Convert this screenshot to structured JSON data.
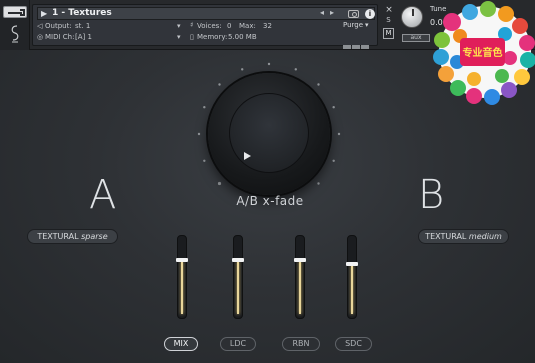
{
  "header": {
    "instrument_name": "1 - Textures",
    "output_label": "Output:",
    "output_value": "st. 1",
    "midi_label": "MIDI Ch:",
    "midi_value": "[A]  1",
    "voices_label": "Voices:",
    "voices_value": "0",
    "max_label": "Max:",
    "max_value": "32",
    "memory_label": "Memory:",
    "memory_value": "5.00 MB",
    "purge_label": "Purge",
    "info_label": "i",
    "close_label": "×",
    "s_label": "S",
    "m_label": "M",
    "tune_label": "Tune",
    "tune_value": "0.00",
    "aux_label": "aux"
  },
  "main": {
    "knob_label": "A/B x-fade",
    "knob_value": 0.0,
    "a_letter": "A",
    "b_letter": "B",
    "preset_a": {
      "name": "TEXTURAL",
      "variant": "sparse"
    },
    "preset_b": {
      "name": "TEXTURAL",
      "variant": "medium"
    }
  },
  "faders": [
    {
      "id": "mix",
      "level": 0.8
    },
    {
      "id": "ldc",
      "level": 0.8
    },
    {
      "id": "rbn",
      "level": 0.8
    },
    {
      "id": "sdc",
      "level": 0.75
    }
  ],
  "bottom_buttons": [
    {
      "label": "MIX",
      "active": true
    },
    {
      "label": "LDC",
      "active": false
    },
    {
      "label": "RBN",
      "active": false
    },
    {
      "label": "SDC",
      "active": false
    }
  ],
  "sticker_text": "专业音色",
  "colors": {
    "accent_fill": "#e9d69a",
    "background": "#2e3135"
  }
}
